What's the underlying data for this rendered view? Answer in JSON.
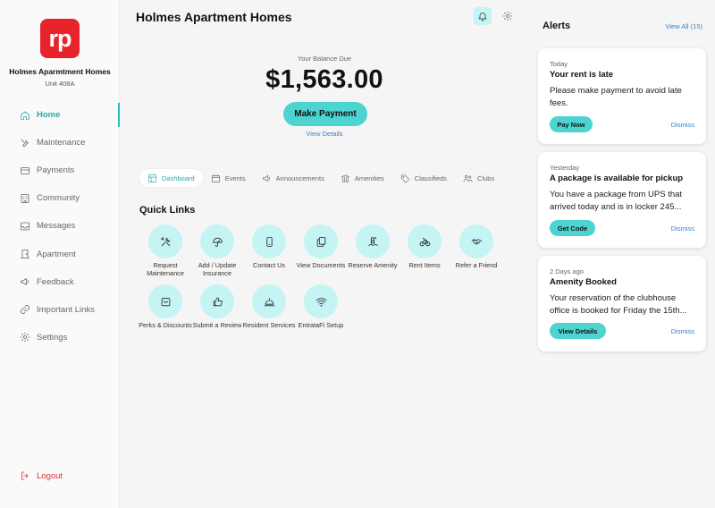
{
  "sidebar": {
    "logo_text": "rp",
    "property_name": "Holmes Aparmtment Homes",
    "unit": "Unit 408A",
    "items": [
      {
        "label": "Home",
        "icon": "home-icon"
      },
      {
        "label": "Maintenance",
        "icon": "wrench-icon"
      },
      {
        "label": "Payments",
        "icon": "credit-card-icon"
      },
      {
        "label": "Community",
        "icon": "building-icon"
      },
      {
        "label": "Messages",
        "icon": "inbox-icon"
      },
      {
        "label": "Apartment",
        "icon": "door-icon"
      },
      {
        "label": "Feedback",
        "icon": "megaphone-icon"
      },
      {
        "label": "Important Links",
        "icon": "link-icon"
      },
      {
        "label": "Settings",
        "icon": "gear-icon"
      }
    ],
    "logout_label": "Logout"
  },
  "header": {
    "title": "Holmes Apartment Homes"
  },
  "balance": {
    "label": "Your Balance Due",
    "amount": "$1,563.00",
    "pay_button": "Make Payment",
    "view_details": "View Details"
  },
  "tabs": [
    {
      "label": "Dashboard",
      "icon": "dashboard-icon"
    },
    {
      "label": "Events",
      "icon": "calendar-icon"
    },
    {
      "label": "Announcements",
      "icon": "megaphone-icon"
    },
    {
      "label": "Amenities",
      "icon": "amenities-icon"
    },
    {
      "label": "Classifieds",
      "icon": "tag-icon"
    },
    {
      "label": "Clubs",
      "icon": "users-icon"
    }
  ],
  "quick_links": {
    "title": "Quick Links",
    "items": [
      {
        "label": "Request Maintenance",
        "icon": "tools-icon"
      },
      {
        "label": "Add / Update Insurance",
        "icon": "umbrella-icon"
      },
      {
        "label": "Contact Us",
        "icon": "phone-icon"
      },
      {
        "label": "View Documents",
        "icon": "documents-icon"
      },
      {
        "label": "Reserve Amenity",
        "icon": "pool-icon"
      },
      {
        "label": "Rent Items",
        "icon": "bike-icon"
      },
      {
        "label": "Refer a Friend",
        "icon": "handshake-icon"
      },
      {
        "label": "Perks & Discounts",
        "icon": "gift-icon"
      },
      {
        "label": "Submit a Review",
        "icon": "thumbs-up-icon"
      },
      {
        "label": "Resident Services",
        "icon": "bell-service-icon"
      },
      {
        "label": "EntrataFi Setup",
        "icon": "wifi-icon"
      }
    ]
  },
  "alerts": {
    "title": "Alerts",
    "view_all": "View All (15)",
    "dismiss_label": "Dismiss",
    "items": [
      {
        "when": "Today",
        "title": "Your rent is late",
        "body": "Please make payment to avoid late fees.",
        "button": "Pay Now"
      },
      {
        "when": "Yesterday",
        "title": "A package is available for pickup",
        "body": "You have a package from UPS that arrived today and is in locker 245...",
        "button": "Get Code"
      },
      {
        "when": "2 Days ago",
        "title": "Amenity Booked",
        "body": "Your reservation of the clubhouse office is booked for Friday the 15th...",
        "button": "View Details"
      }
    ]
  },
  "colors": {
    "brand_red": "#e8232b",
    "accent_teal": "#4dd4d1",
    "active_teal": "#26a8a8",
    "link_blue": "#3a82c4",
    "icon_bg": "#c4f4f4"
  }
}
